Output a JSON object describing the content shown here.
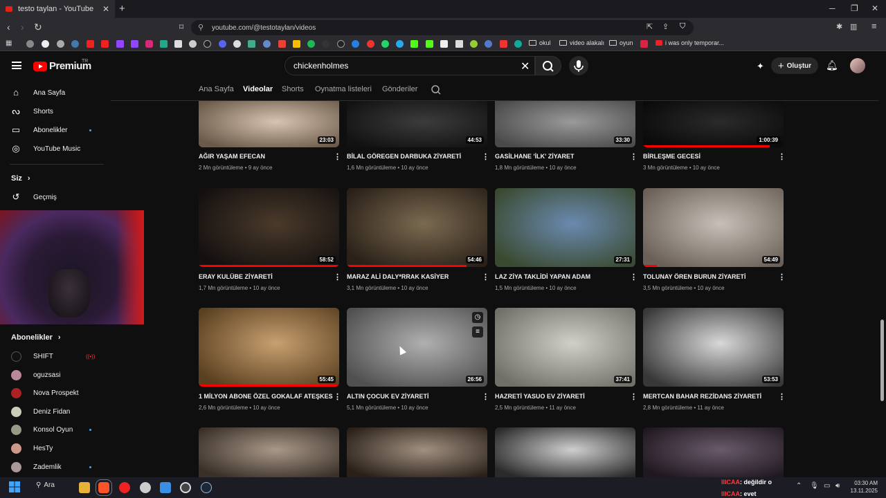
{
  "browser": {
    "tab_title": "testo taylan - YouTube",
    "url": "youtube.com/@testotaylan/videos",
    "bookmark_folders": [
      "okul",
      "video alakalı",
      "oyun"
    ],
    "bookmark_last": "i was only temporar..."
  },
  "youtube": {
    "logo_text": "Premium",
    "logo_sup": "TR",
    "search_value": "chickenholmes",
    "create_label": "Oluştur"
  },
  "sidebar": {
    "items": [
      {
        "label": "Ana Sayfa",
        "icon": "home-icon"
      },
      {
        "label": "Shorts",
        "icon": "shorts-icon"
      },
      {
        "label": "Abonelikler",
        "icon": "subscriptions-icon"
      },
      {
        "label": "YouTube Music",
        "icon": "youtube-music-icon"
      }
    ],
    "you_header": "Siz",
    "history": "Geçmiş",
    "subs_header": "Abonelikler",
    "subscriptions": [
      "SHIFT",
      "oguzsasi",
      "Nova Prospekt",
      "Deniz Fidan",
      "Konsol Oyun",
      "HesTy",
      "Zademlik"
    ]
  },
  "channel_tabs": [
    "Ana Sayfa",
    "Videolar",
    "Shorts",
    "Oynatma listeleri",
    "Gönderiler"
  ],
  "videos": [
    {
      "title": "AĞIR YAŞAM EFECAN",
      "meta": "2 Mn görüntüleme • 9 ay önce",
      "duration": "23:03",
      "progress": 0
    },
    {
      "title": "BİLAL GÖREGEN DARBUKA ZİYARETİ",
      "meta": "1,6 Mn görüntüleme • 10 ay önce",
      "duration": "44:53",
      "progress": 0
    },
    {
      "title": "GASİLHANE 'İLK' ZİYARET",
      "meta": "1,8 Mn görüntüleme • 10 ay önce",
      "duration": "33:30",
      "progress": 0
    },
    {
      "title": "BİRLEŞME GECESİ",
      "meta": "3 Mn görüntüleme • 10 ay önce",
      "duration": "1:00:39",
      "progress": 0.9
    },
    {
      "title": "ERAY KULÜBE ZİYARETİ",
      "meta": "1,7 Mn görüntüleme • 10 ay önce",
      "duration": "58:52",
      "progress": 1
    },
    {
      "title": "MARAZ ALİ DALY*RRAK KASİYER",
      "meta": "3,1 Mn görüntüleme • 10 ay önce",
      "duration": "54:46",
      "progress": 0.85
    },
    {
      "title": "LAZ ZİYA TAKLİDİ YAPAN ADAM",
      "meta": "1,5 Mn görüntüleme • 10 ay önce",
      "duration": "27:31",
      "progress": 0
    },
    {
      "title": "TOLUNAY ÖREN BURUN ZİYARETİ",
      "meta": "3,5 Mn görüntüleme • 10 ay önce",
      "duration": "54:49",
      "progress": 0.1
    },
    {
      "title": "1 MİLYON ABONE ÖZEL GOKALAF ATEŞKES",
      "meta": "2,6 Mn görüntüleme • 10 ay önce",
      "duration": "55:45",
      "progress": 1
    },
    {
      "title": "ALTIN ÇOCUK EV ZİYARETİ",
      "meta": "5,1 Mn görüntüleme • 10 ay önce",
      "duration": "26:56",
      "progress": 0
    },
    {
      "title": "HAZRETİ YASUO EV ZİYARETİ",
      "meta": "2,5 Mn görüntüleme • 11 ay önce",
      "duration": "37:41",
      "progress": 0
    },
    {
      "title": "MERTCAN BAHAR REZİDANS ZİYARETİ",
      "meta": "2,8 Mn görüntüleme • 11 ay önce",
      "duration": "53:53",
      "progress": 0
    },
    {
      "title": "",
      "meta": "",
      "duration": "",
      "progress": 0
    },
    {
      "title": "",
      "meta": "",
      "duration": "",
      "progress": 0
    },
    {
      "title": "",
      "meta": "",
      "duration": "",
      "progress": 0
    },
    {
      "title": "",
      "meta": "",
      "duration": "",
      "progress": 0
    }
  ],
  "taskbar": {
    "search_label": "Ara",
    "chat": [
      {
        "user": "IIICAA",
        "text": ": değildir o"
      },
      {
        "user": "IIICAA",
        "text": ": evet"
      }
    ],
    "time": "03:30 AM",
    "date": "13.11.2025"
  },
  "colors": {
    "accent": "#ff0000",
    "link": "#3ea6ff"
  }
}
